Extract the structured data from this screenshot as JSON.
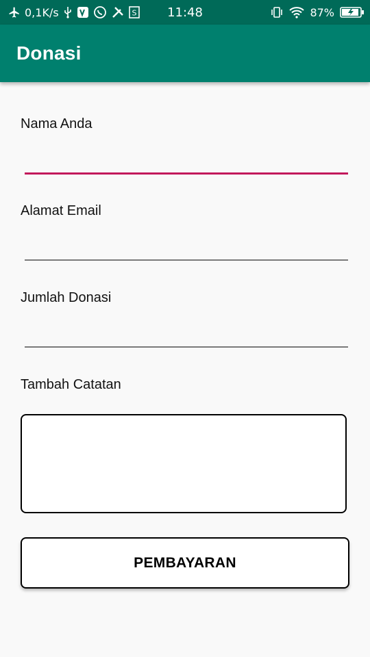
{
  "status_bar": {
    "speed": "0,1K/s",
    "time": "11:48",
    "battery": "87%",
    "icons_left": [
      "airplane-icon",
      "usb-icon",
      "vpn-app-icon",
      "whatsapp-icon",
      "tools-icon",
      "s-app-icon"
    ],
    "icons_right": [
      "vibrate-icon",
      "wifi-icon",
      "battery-charging-icon"
    ],
    "colors": {
      "background": "#006a58",
      "text": "#ffffff"
    }
  },
  "app_bar": {
    "title": "Donasi",
    "color": "#00806e"
  },
  "form": {
    "name_label": "Nama Anda",
    "email_label": "Alamat Email",
    "amount_label": "Jumlah Donasi",
    "notes_label": "Tambah Catatan",
    "name_value": "",
    "email_value": "",
    "amount_value": "",
    "notes_value": "",
    "focus_accent": "#c2185b"
  },
  "payment_button": {
    "label": "PEMBAYARAN"
  }
}
